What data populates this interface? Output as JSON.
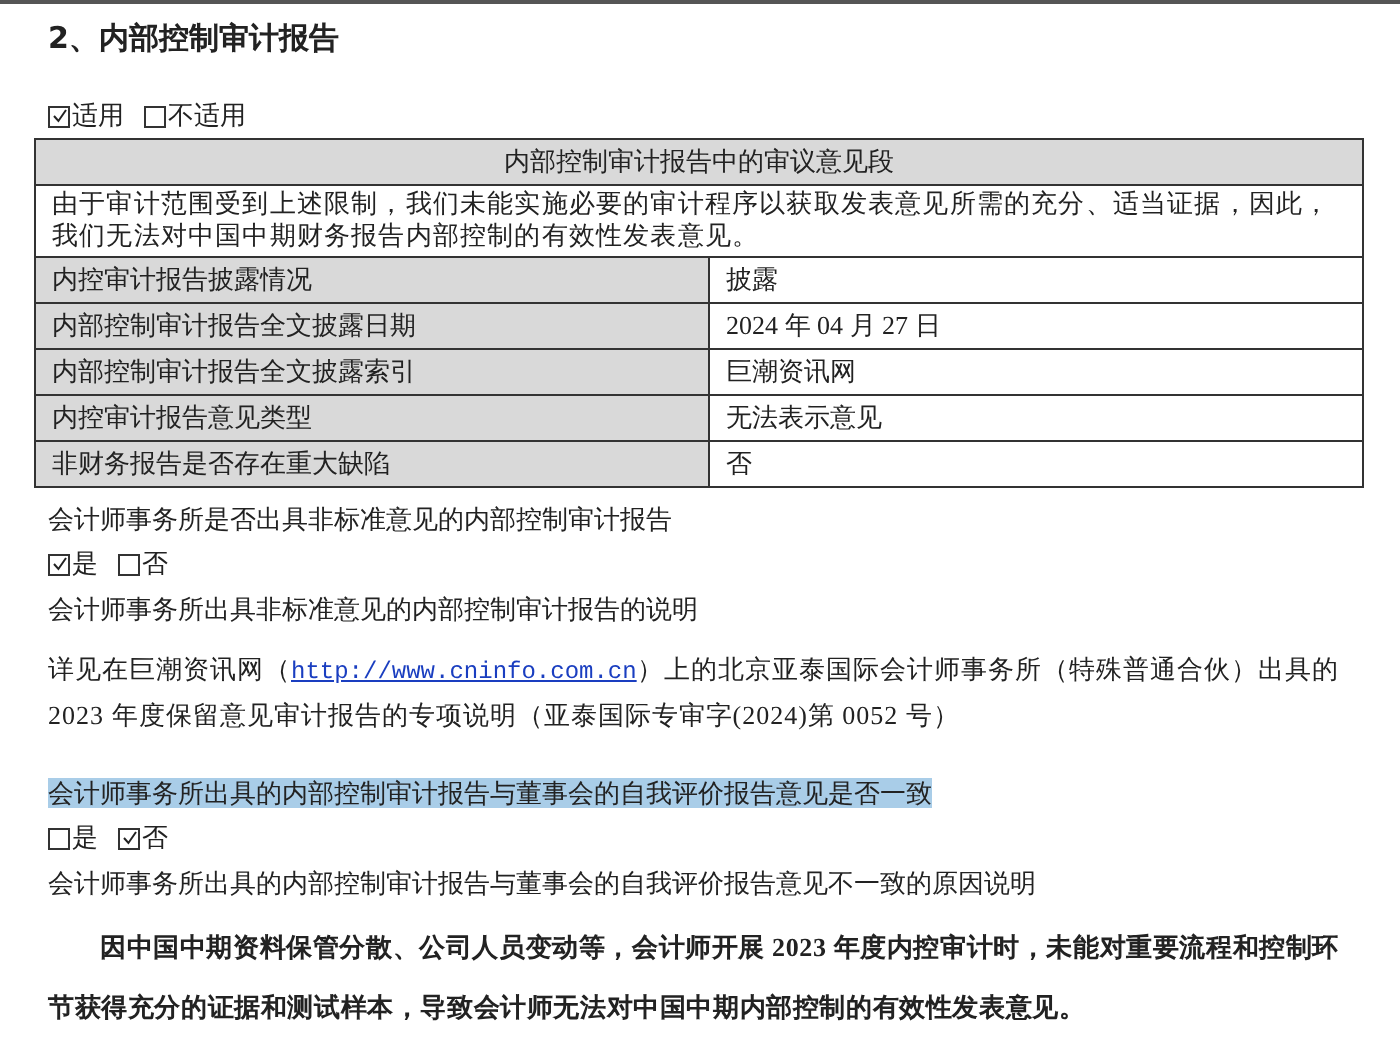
{
  "heading": "2、内部控制审计报告",
  "applicability": [
    {
      "label": "适用",
      "checked": true
    },
    {
      "label": "不适用",
      "checked": false
    }
  ],
  "table": {
    "header": "内部控制审计报告中的审议意见段",
    "opinion": "由于审计范围受到上述限制，我们未能实施必要的审计程序以获取发表意见所需的充分、适当证据，因此，我们无法对中国中期财务报告内部控制的有效性发表意见。",
    "rows": [
      {
        "label": "内控审计报告披露情况",
        "value": "披露"
      },
      {
        "label": "内部控制审计报告全文披露日期",
        "value": "2024 年 04 月 27 日"
      },
      {
        "label": "内部控制审计报告全文披露索引",
        "value": "巨潮资讯网"
      },
      {
        "label": "内控审计报告意见类型",
        "value": "无法表示意见"
      },
      {
        "label": "非财务报告是否存在重大缺陷",
        "value": "否"
      }
    ]
  },
  "sections": [
    {
      "question": "会计师事务所是否出具非标准意见的内部控制审计报告",
      "highlighted": false,
      "options": [
        {
          "label": "是",
          "checked": true
        },
        {
          "label": "否",
          "checked": false
        }
      ],
      "explanation_title": "会计师事务所出具非标准意见的内部控制审计报告的说明",
      "explanation": {
        "before": "详见在巨潮资讯网（",
        "link": "http://www.cninfo.com.cn",
        "after": "）上的北京亚泰国际会计师事务所（特殊普通合伙）出具的 2023 年度保留意见审计报告的专项说明（亚泰国际专审字(2024)第 0052 号）",
        "bold": false
      }
    },
    {
      "question": "会计师事务所出具的内部控制审计报告与董事会的自我评价报告意见是否一致",
      "highlighted": true,
      "options": [
        {
          "label": "是",
          "checked": false
        },
        {
          "label": "否",
          "checked": true
        }
      ],
      "explanation_title": "会计师事务所出具的内部控制审计报告与董事会的自我评价报告意见不一致的原因说明",
      "explanation": {
        "before": "因中国中期资料保管分散、公司人员变动等，会计师开展 2023 年度内控审计时，未能对重要流程和控制环节获得充分的证据和测试样本，导致会计师无法对中国中期内部控制的有效性发表意见。",
        "bold": true
      }
    }
  ]
}
